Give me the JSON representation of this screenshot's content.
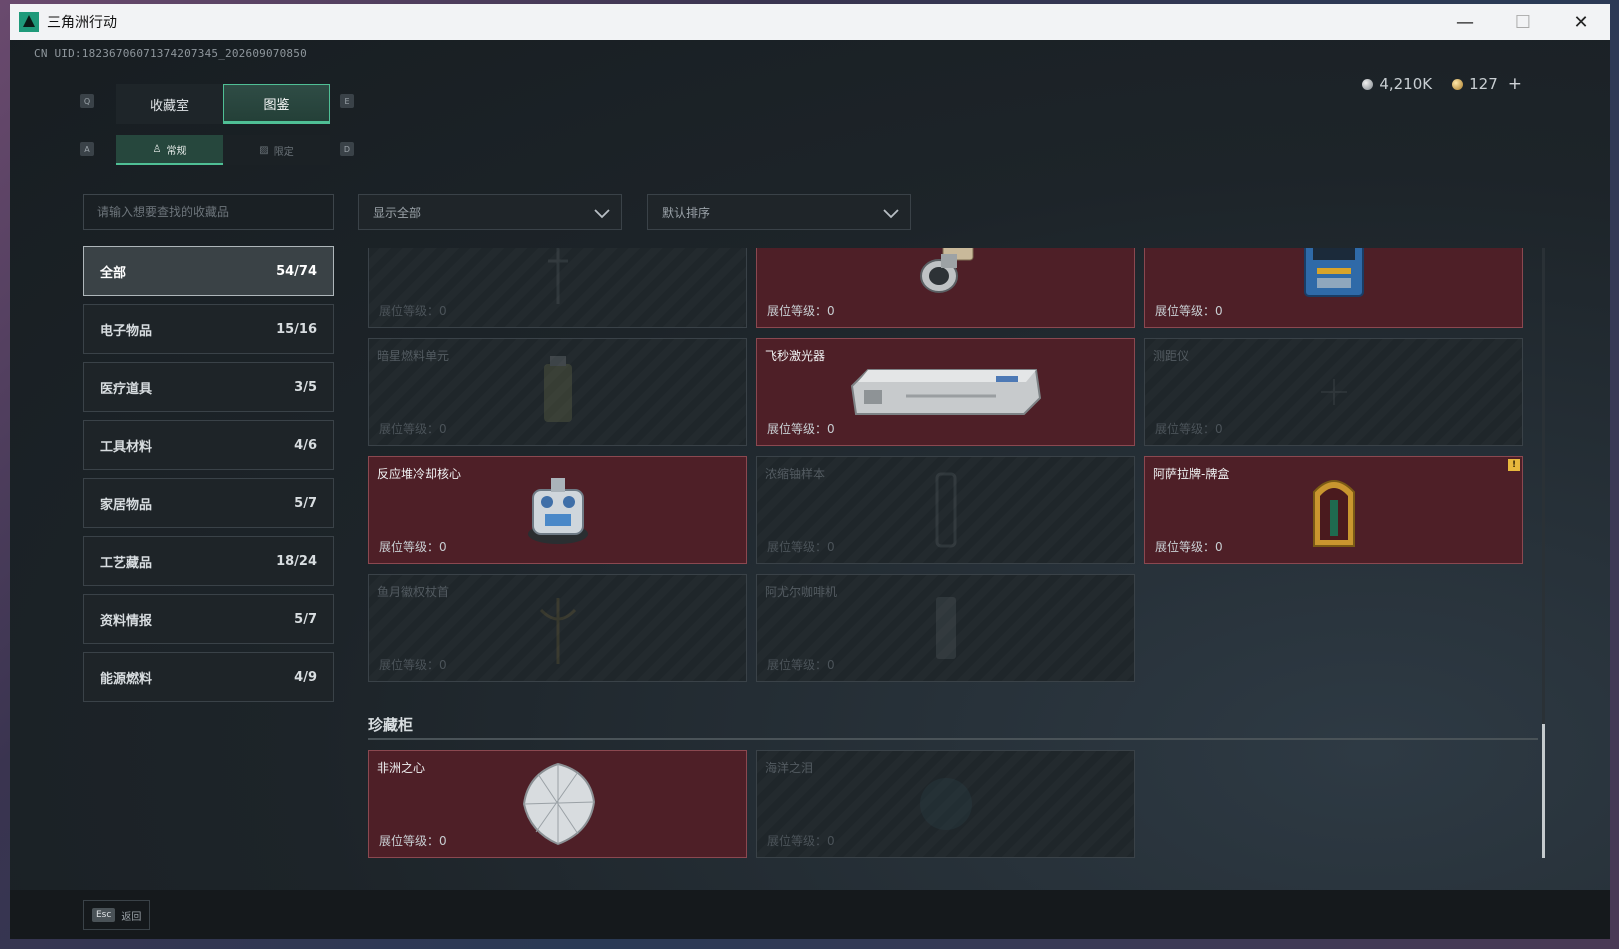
{
  "window": {
    "title": "三角洲行动",
    "controls": {
      "minimize": "—",
      "maximize": "☐",
      "close": "✕"
    }
  },
  "uid": "CN UID:18236706071374207345_202609070850",
  "currency": {
    "silver": "4,210K",
    "gold": "127",
    "plus": "+"
  },
  "key_hints": {
    "prev_main": "Q",
    "next_main": "E",
    "prev_sub": "A",
    "next_sub": "D"
  },
  "tabs": {
    "collection_room": "收藏室",
    "codex": "图鉴"
  },
  "subtabs": {
    "regular": "常规",
    "limited": "限定"
  },
  "search": {
    "placeholder": "请输入想要查找的收藏品"
  },
  "filters": {
    "show": "显示全部",
    "sort": "默认排序"
  },
  "categories": [
    {
      "label": "全部",
      "count": "54/74"
    },
    {
      "label": "电子物品",
      "count": "15/16"
    },
    {
      "label": "医疗道具",
      "count": "3/5"
    },
    {
      "label": "工具材料",
      "count": "4/6"
    },
    {
      "label": "家居物品",
      "count": "5/7"
    },
    {
      "label": "工艺藏品",
      "count": "18/24"
    },
    {
      "label": "资料情报",
      "count": "5/7"
    },
    {
      "label": "能源燃料",
      "count": "4/9"
    }
  ],
  "level_label": "展位等级：0",
  "items": {
    "r0c0": {
      "name": "",
      "level": "展位等级：0"
    },
    "r0c1": {
      "name": "",
      "level": "展位等级：0"
    },
    "r0c2": {
      "name": "",
      "level": "展位等级：0"
    },
    "r1c0": {
      "name": "暗星燃料单元",
      "level": "展位等级：0"
    },
    "r1c1": {
      "name": "飞秒激光器",
      "level": "展位等级：0"
    },
    "r1c2": {
      "name": "测距仪",
      "level": "展位等级：0"
    },
    "r2c0": {
      "name": "反应堆冷却核心",
      "level": "展位等级：0"
    },
    "r2c1": {
      "name": "浓缩铀样本",
      "level": "展位等级：0"
    },
    "r2c2": {
      "name": "阿萨拉牌-牌盒",
      "level": "展位等级：0",
      "badge": "!"
    },
    "r3c0": {
      "name": "鱼月徽权杖首",
      "level": "展位等级：0"
    },
    "r3c1": {
      "name": "阿尤尔咖啡机",
      "level": "展位等级：0"
    }
  },
  "section": {
    "title": "珍藏柜"
  },
  "treasure": {
    "t0": {
      "name": "非洲之心",
      "level": "展位等级：0"
    },
    "t1": {
      "name": "海洋之泪",
      "level": "展位等级：0"
    }
  },
  "footer": {
    "esc": "Esc",
    "back": "返回"
  }
}
